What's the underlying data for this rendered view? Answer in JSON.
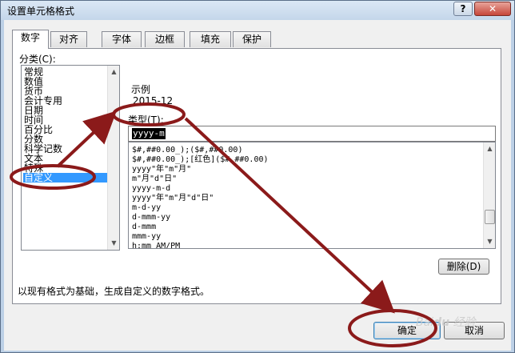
{
  "window": {
    "title": "设置单元格格式",
    "help_label": "?",
    "close_label": "✕"
  },
  "tabs": [
    {
      "label": "数字",
      "active": true
    },
    {
      "label": "对齐",
      "active": false
    },
    {
      "label": "字体",
      "active": false
    },
    {
      "label": "边框",
      "active": false
    },
    {
      "label": "填充",
      "active": false
    },
    {
      "label": "保护",
      "active": false
    }
  ],
  "category": {
    "label": "分类(C):",
    "items": [
      "常规",
      "数值",
      "货币",
      "会计专用",
      "日期",
      "时间",
      "百分比",
      "分数",
      "科学记数",
      "文本",
      "特殊",
      "自定义"
    ],
    "selected": "自定义"
  },
  "sample": {
    "label": "示例",
    "value": "2015-12"
  },
  "type": {
    "label": "类型(T):",
    "value": "yyyy-m"
  },
  "formats": [
    "$#,##0.00_);($#,##0.00)",
    "$#,##0.00_);[红色]($#,##0.00)",
    "yyyy\"年\"m\"月\"",
    "m\"月\"d\"日\"",
    "yyyy-m-d",
    "yyyy\"年\"m\"月\"d\"日\"",
    "m-d-yy",
    "d-mmm-yy",
    "d-mmm",
    "mmm-yy",
    "h:mm AM/PM"
  ],
  "buttons": {
    "delete": "删除(D)",
    "ok": "确定",
    "cancel": "取消"
  },
  "hint": "以现有格式为基础，生成自定义的数字格式。",
  "annotation_color": "#8b1a1a",
  "watermark": "Baidu 经验"
}
